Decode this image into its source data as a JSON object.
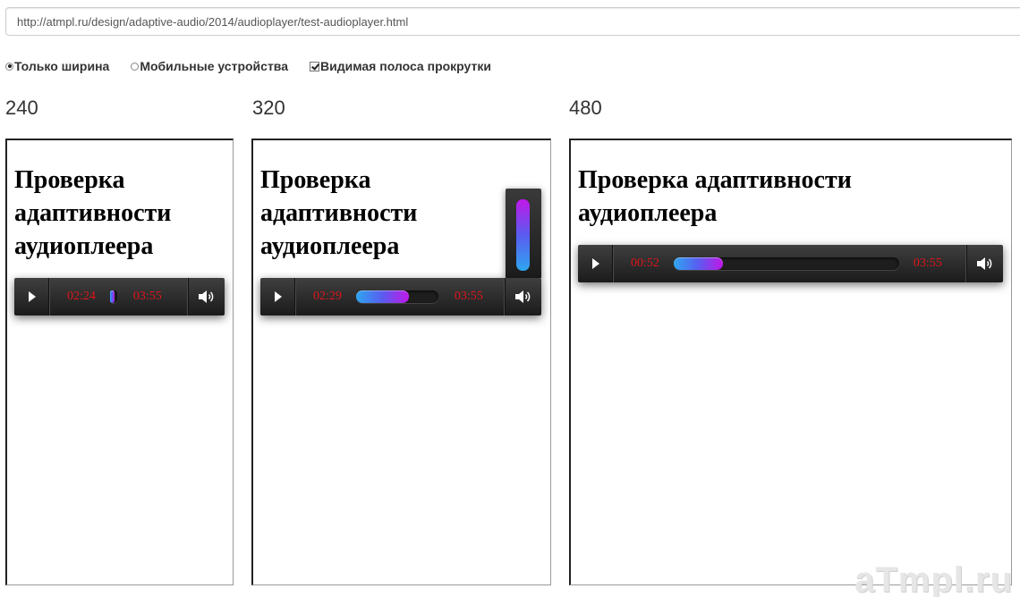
{
  "address_bar": {
    "url": "http://atmpl.ru/design/adaptive-audio/2014/audioplayer/test-audioplayer.html"
  },
  "options": {
    "width_only": {
      "label": "Только ширина",
      "checked": true
    },
    "mobile_devices": {
      "label": "Мобильные устройства",
      "checked": false
    },
    "visible_scrollbar": {
      "label": "Видимая полоса прокрутки",
      "checked": true
    }
  },
  "columns": [
    {
      "width_label": "240",
      "heading_lines": [
        "Проверка",
        "адаптивности",
        "аудиоплеера"
      ],
      "player": {
        "current_time": "02:24",
        "duration": "03:55",
        "progress": 0.61,
        "volume_popup_open": false
      }
    },
    {
      "width_label": "320",
      "heading_lines": [
        "Проверка",
        "адаптивности",
        "аудиоплеера"
      ],
      "player": {
        "current_time": "02:29",
        "duration": "03:55",
        "progress": 0.64,
        "volume_popup_open": true,
        "volume": 1.0
      }
    },
    {
      "width_label": "480",
      "heading_lines": [
        "Проверка адаптивности",
        "аудиоплеера"
      ],
      "player": {
        "current_time": "00:52",
        "duration": "03:55",
        "progress": 0.22,
        "volume_popup_open": false
      }
    }
  ],
  "watermark": "aTmpl.ru",
  "colors": {
    "time_text": "#e0141a",
    "progress_start": "#2ea6f0",
    "progress_end": "#c118e8",
    "player_bg": "#2a2a2a"
  },
  "icons": {
    "play": "play-icon",
    "volume": "speaker-icon"
  }
}
